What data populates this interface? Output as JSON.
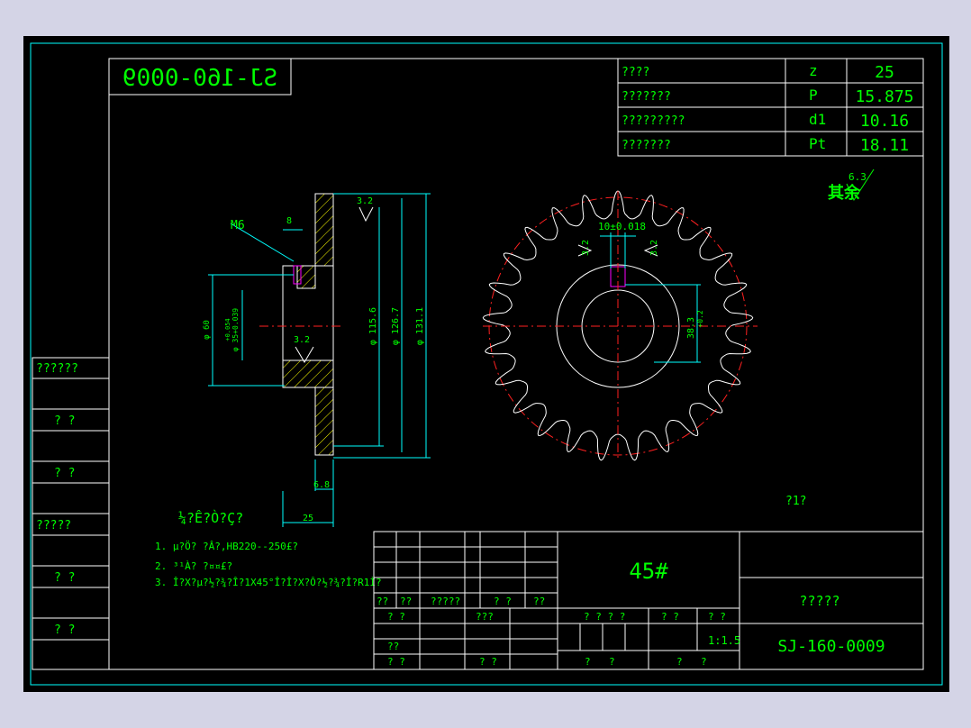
{
  "drawing_number_mirrored": "SJ-160-0009",
  "params": [
    {
      "name": "????",
      "symbol": "z",
      "value": "25"
    },
    {
      "name": "???????",
      "symbol": "P",
      "value": "15.875"
    },
    {
      "name": "?????????",
      "symbol": "d1",
      "value": "10.16"
    },
    {
      "name": "???????",
      "symbol": "Pt",
      "value": "18.11"
    }
  ],
  "roughness": {
    "label": "其余",
    "value": "6.3"
  },
  "side_labels": [
    "??????",
    "?  ?",
    "?  ?",
    "?????",
    "?  ?",
    "?  ?"
  ],
  "side_view": {
    "thread": "M6",
    "dim_8": "8",
    "dim_6_8": "6.8",
    "dim_25": "25",
    "rough_top": "3.2",
    "rough_mid": "3.2",
    "d60": "φ 60",
    "bore": "φ 35+0.039",
    "bore_tol": "+0.054",
    "d115": "φ 115.6",
    "d126": "φ 126.7",
    "d131": "φ 131.1"
  },
  "front_view": {
    "keyway": "10±0.018",
    "rough_left": "3.2",
    "rough_right": "3.2",
    "depth": "38.3",
    "depth_tol": "+0.2",
    "scale_note": "?1?"
  },
  "notes": {
    "title": "¼?Ê?Ò?Ç?",
    "lines": [
      "1. µ?Ö? ?Â?,HB220--250£?",
      "2. ³¹À? ?¤¤£?",
      "3. Î?X?µ?½?¾?Î?1X45°Î?Î?X?Ô?½?¾?Î?R1Ì?"
    ]
  },
  "title_block": {
    "material": "45#",
    "part_name": "?????",
    "drawing_no": "SJ-160-0009",
    "row_labels": [
      "??",
      "??",
      "?????",
      "? ?",
      "??"
    ],
    "approve_labels": [
      "? ?",
      "???",
      "??",
      "? ?",
      "? ?",
      "? ?"
    ],
    "stage_label": "? ? ? ?",
    "weight_label": "? ?",
    "scale_label": "? ?",
    "scale_value": "1:1.5",
    "sheet_labels": [
      "?",
      "?",
      "?",
      "?"
    ]
  },
  "colors": {
    "frame": "#ffffff",
    "cyan": "#00ffff",
    "green": "#00ff00",
    "red": "#ff2020",
    "magenta": "#ff00ff",
    "yellow": "#ffff00"
  }
}
